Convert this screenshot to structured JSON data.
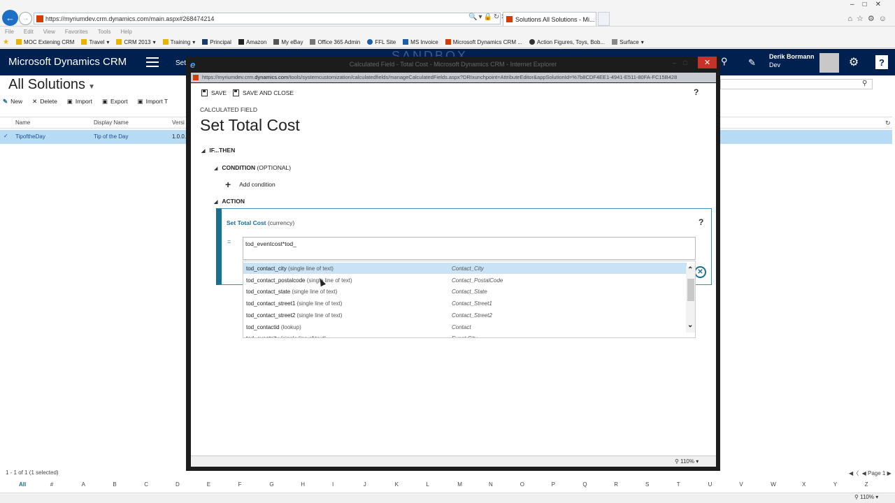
{
  "browser": {
    "url": "https://myriumdev.crm.dynamics.com/main.aspx#268474214",
    "tab_title": "Solutions All Solutions - Mi...",
    "menu": [
      "File",
      "Edit",
      "View",
      "Favorites",
      "Tools",
      "Help"
    ],
    "favorites": [
      "MOC Extening CRM",
      "Travel",
      "CRM 2013",
      "Training",
      "Principal",
      "Amazon",
      "My eBay",
      "Office 365 Admin",
      "FFL Site",
      "MS Invoice",
      "Microsoft Dynamics CRM ...",
      "Action Figures, Toys, Bob...",
      "Surface"
    ]
  },
  "crm": {
    "app_title": "Microsoft Dynamics CRM",
    "nav_set": "Set",
    "sandbox": "SANDBOX",
    "user_name": "Derik Bormann",
    "user_role": "Dev"
  },
  "solutions": {
    "title": "All Solutions",
    "toolbar": [
      "New",
      "Delete",
      "Import",
      "Export",
      "Import T"
    ],
    "columns": [
      "Name",
      "Display Name",
      "Versi"
    ],
    "row": {
      "name": "TipoftheDay",
      "display_name": "Tip of the Day",
      "version": "1.0.0."
    },
    "footer": "1 - 1 of 1 (1 selected)",
    "pager": "Page 1",
    "alphabet": [
      "All",
      "#",
      "A",
      "B",
      "C",
      "D",
      "E",
      "F",
      "G",
      "H",
      "I",
      "J",
      "K",
      "L",
      "M",
      "N",
      "O",
      "P",
      "Q",
      "R",
      "S",
      "T",
      "U",
      "V",
      "W",
      "X",
      "Y",
      "Z"
    ],
    "zoom": "110%"
  },
  "popup": {
    "title": "Calculated Field - Total Cost - Microsoft Dynamics CRM - Internet Explorer",
    "url_prefix": "https://myriumdev.crm.",
    "url_host": "dynamics.com",
    "url_rest": "/tools/systemcustomization/calculatedfields/manageCalculatedFields.aspx?DRIxunchpoint=AttributeEditor&appSolutionId=%7b8CDF4EE1-4941-E511-80FA-FC15B428",
    "zoom": "110%"
  },
  "editor": {
    "save_label": "SAVE",
    "save_close_label": "SAVE AND CLOSE",
    "help": "?",
    "calc_label": "CALCULATED FIELD",
    "field_title": "Set Total Cost",
    "ifthen_label": "IF...THEN",
    "condition_label": "CONDITION",
    "condition_optional": "(OPTIONAL)",
    "add_condition": "Add condition",
    "action_label": "ACTION",
    "set_label": "Set Total Cost",
    "set_type": "(currency)",
    "equals": "=",
    "formula": "tod_eventcost*tod_"
  },
  "suggestions": [
    {
      "name": "tod_contact_city",
      "type": "(single line of text)",
      "display": "Contact_City"
    },
    {
      "name": "tod_contact_postalcode",
      "type": "(single line of text)",
      "display": "Contact_PostalCode"
    },
    {
      "name": "tod_contact_state",
      "type": "(single line of text)",
      "display": "Contact_State"
    },
    {
      "name": "tod_contact_street1",
      "type": "(single line of text)",
      "display": "Contact_Street1"
    },
    {
      "name": "tod_contact_street2",
      "type": "(single line of text)",
      "display": "Contact_Street2"
    },
    {
      "name": "tod_contactid",
      "type": "(lookup)",
      "display": "Contact"
    },
    {
      "name": "tod_eventcity",
      "type": "(single line of text)",
      "display": "Event City"
    }
  ],
  "colors": {
    "crm_nav": "#002050",
    "accent": "#1a6e8f",
    "selection": "#b7dbf4",
    "close_red": "#c7312a"
  }
}
